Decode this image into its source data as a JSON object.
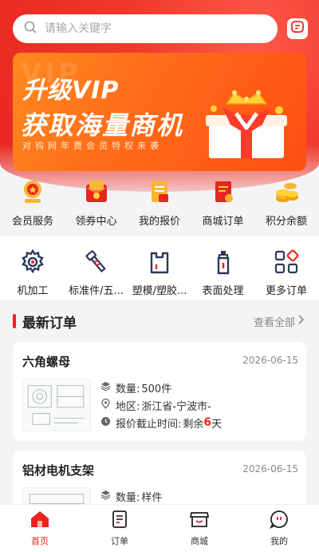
{
  "search": {
    "placeholder": "请输入关键字"
  },
  "banner": {
    "line1": "升级VIP",
    "line2": "获取海量商机",
    "line3": "对钩网年费会员特权来袭"
  },
  "quick_row1": [
    {
      "label": "会员服务",
      "icon": "member-badge-icon"
    },
    {
      "label": "领券中心",
      "icon": "coupon-icon"
    },
    {
      "label": "我的报价",
      "icon": "quote-scroll-icon"
    },
    {
      "label": "商城订单",
      "icon": "order-doc-icon"
    },
    {
      "label": "积分余额",
      "icon": "coins-icon"
    }
  ],
  "quick_row2": [
    {
      "label": "机加工",
      "icon": "gear-icon"
    },
    {
      "label": "标准件/五...",
      "icon": "screw-icon"
    },
    {
      "label": "塑模/塑胶...",
      "icon": "plastic-bag-icon"
    },
    {
      "label": "表面处理",
      "icon": "spray-bottle-icon"
    },
    {
      "label": "更多订单",
      "icon": "grid-more-icon"
    }
  ],
  "section": {
    "title": "最新订单",
    "more": "查看全部"
  },
  "orders": [
    {
      "name": "六角螺母",
      "date": "2026-06-15",
      "qty_key": "数量:",
      "qty": "500件",
      "region_key": "地区:",
      "region": "浙江省-宁波市-",
      "deadline_key": "报价截止时间:",
      "deadline_prefix": "剩余",
      "deadline_days": "6",
      "deadline_suffix": "天"
    },
    {
      "name": "铝材电机支架",
      "date": "2026-06-15",
      "qty_key": "数量:",
      "qty": "样件"
    }
  ],
  "tabs": [
    {
      "label": "首页",
      "active": true
    },
    {
      "label": "订单"
    },
    {
      "label": "商城"
    },
    {
      "label": "我的"
    }
  ],
  "colors": {
    "brand": "#e8261f",
    "banner": "#ff6a1a"
  }
}
